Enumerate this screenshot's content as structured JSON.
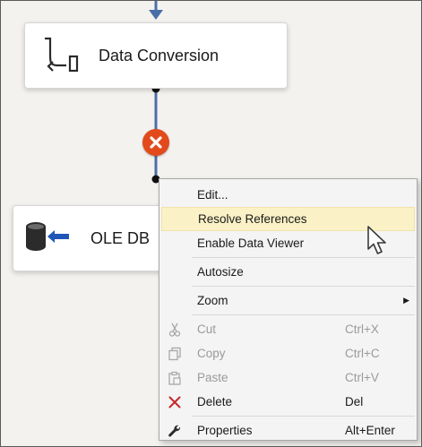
{
  "design_surface": {
    "tasks": [
      {
        "label": "Data Conversion",
        "icon": "data-conversion-icon"
      },
      {
        "label": "OLE DB",
        "icon": "ole-db-source-icon"
      }
    ],
    "connector": {
      "status": "error",
      "badge_icon": "error-x-icon",
      "badge_color": "#e24a1c",
      "line_color": "#4a6fa8"
    }
  },
  "context_menu": {
    "items": [
      {
        "label": "Edit...",
        "shortcut": "",
        "enabled": true
      },
      {
        "label": "Resolve References",
        "shortcut": "",
        "enabled": true,
        "highlighted": true
      },
      {
        "label": "Enable Data Viewer",
        "shortcut": "",
        "enabled": true
      },
      {
        "label": "Autosize",
        "shortcut": "",
        "enabled": true
      },
      {
        "label": "Zoom",
        "shortcut": "",
        "enabled": true,
        "submenu": true
      },
      {
        "label": "Cut",
        "shortcut": "Ctrl+X",
        "enabled": false,
        "icon": "scissors-icon"
      },
      {
        "label": "Copy",
        "shortcut": "Ctrl+C",
        "enabled": false,
        "icon": "copy-icon"
      },
      {
        "label": "Paste",
        "shortcut": "Ctrl+V",
        "enabled": false,
        "icon": "paste-icon"
      },
      {
        "label": "Delete",
        "shortcut": "Del",
        "enabled": true,
        "icon": "delete-x-icon"
      },
      {
        "label": "Properties",
        "shortcut": "Alt+Enter",
        "enabled": true,
        "icon": "wrench-icon"
      }
    ],
    "highlight_color": "#fbf1c6",
    "delete_icon_color": "#c62828"
  }
}
